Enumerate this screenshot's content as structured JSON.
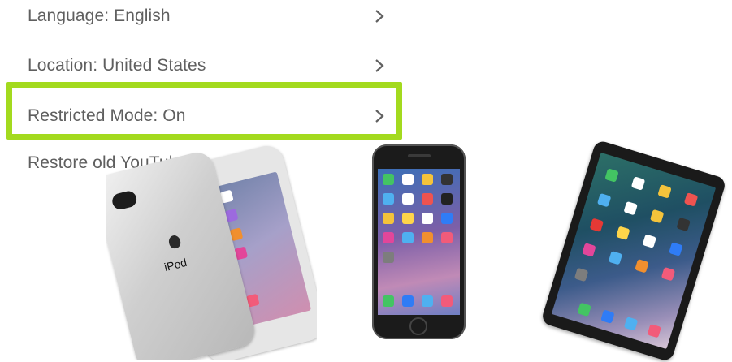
{
  "menu": {
    "items": [
      {
        "label": "Language: English"
      },
      {
        "label": "Location: United States"
      },
      {
        "label": "Restricted Mode: On"
      },
      {
        "label": "Restore old YouTub"
      }
    ]
  },
  "highlight_color": "#a3da1e",
  "devices": {
    "ipod": {
      "brand_text": "iPod"
    },
    "iphone": {},
    "ipad": {}
  },
  "icons": {
    "chevron": "chevron-right-icon",
    "apple_logo": "apple-logo-icon"
  }
}
